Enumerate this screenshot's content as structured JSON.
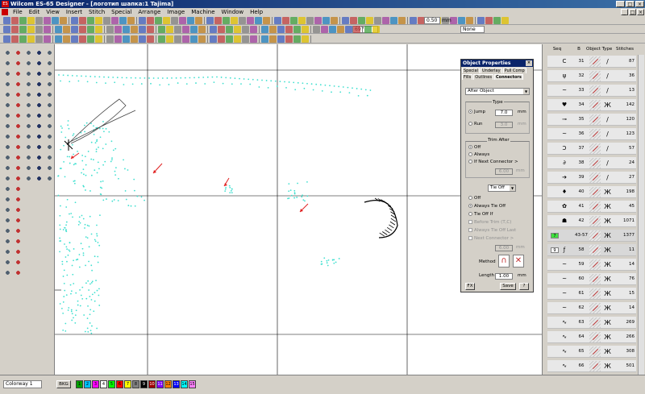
{
  "window": {
    "title": "Wilcom ES-65 Designer - [логотип шапка:1          Tajima]",
    "app_badge": "ES",
    "controls": [
      "_",
      "□",
      "×"
    ]
  },
  "menu": [
    "File",
    "Edit",
    "View",
    "Insert",
    "Stitch",
    "Special",
    "Arrange",
    "Image",
    "Machine",
    "Window",
    "Help"
  ],
  "toolbar": {
    "zoom_value": "697",
    "spacing_value": "0.50",
    "spacing_unit": "mm",
    "color_value": "None"
  },
  "object_properties": {
    "title": "Object Properties",
    "tabs_row1": [
      "Special",
      "Underlay",
      "Pull Comp"
    ],
    "tabs_row2": [
      "Fills",
      "Outlines",
      "Connectors"
    ],
    "active_tab": "Connectors",
    "connector_select": "After Object",
    "type_label": "Type",
    "jump_label": "Jump",
    "jump_value": "7.0",
    "run_label": "Run",
    "run_value": "3.0",
    "unit": "mm",
    "trim_after_label": "Trim After",
    "trim_off": "Off",
    "trim_always": "Always",
    "trim_if_next": "If Next Connector >",
    "trim_if_value": "6.00",
    "tie_select": "Tie Off",
    "tie_off": "Off",
    "tie_always": "Always Tie Off",
    "tie_if": "Tie Off If",
    "before_trim": "Before Trim (T,C)",
    "always_tie_last": "Always Tie Off Last",
    "next_connector": "Next Connector >",
    "next_value": "6.00",
    "method_label": "Method",
    "length_label": "Length",
    "length_value": "1.00",
    "btn_fx": "FX",
    "btn_save": "Save",
    "btn_help": "?"
  },
  "film_panel": {
    "headers": [
      "Seq",
      "B",
      "Object",
      "Type",
      "Stitches"
    ],
    "rows": [
      {
        "num": "31",
        "icon": "C",
        "type": "/",
        "stitches": "87"
      },
      {
        "num": "32",
        "icon": "ψ",
        "type": "/",
        "stitches": "36"
      },
      {
        "num": "33",
        "icon": "~",
        "type": "/",
        "stitches": "13"
      },
      {
        "num": "34",
        "icon": "♥",
        "type": "Ж",
        "stitches": "142"
      },
      {
        "num": "35",
        "icon": "⊸",
        "type": "/",
        "stitches": "120"
      },
      {
        "num": "36",
        "icon": "~",
        "type": "/",
        "stitches": "123"
      },
      {
        "num": "37",
        "icon": "Ɔ",
        "type": "/",
        "stitches": "57"
      },
      {
        "num": "38",
        "icon": "∂",
        "type": "/",
        "stitches": "24"
      },
      {
        "num": "39",
        "icon": "➔",
        "type": "/",
        "stitches": "27"
      },
      {
        "num": "40",
        "icon": "♦",
        "type": "Ж",
        "stitches": "198"
      },
      {
        "num": "41",
        "icon": "✿",
        "type": "Ж",
        "stitches": "45"
      },
      {
        "num": "42",
        "icon": "☗",
        "type": "Ж",
        "stitches": "1071"
      },
      {
        "num": "43-57",
        "icon": "",
        "type": "Ж",
        "stitches": "1377",
        "group": "7"
      },
      {
        "num": "58",
        "icon": "ƒ",
        "type": "Ж",
        "stitches": "11",
        "group": "9"
      },
      {
        "num": "59",
        "icon": "~",
        "type": "Ж",
        "stitches": "14"
      },
      {
        "num": "60",
        "icon": "~",
        "type": "Ж",
        "stitches": "76"
      },
      {
        "num": "61",
        "icon": "~",
        "type": "Ж",
        "stitches": "15"
      },
      {
        "num": "62",
        "icon": "~",
        "type": "Ж",
        "stitches": "14"
      },
      {
        "num": "63",
        "icon": "∿",
        "type": "Ж",
        "stitches": "269"
      },
      {
        "num": "64",
        "icon": "∿",
        "type": "Ж",
        "stitches": "266"
      },
      {
        "num": "65",
        "icon": "∿",
        "type": "Ж",
        "stitches": "308"
      },
      {
        "num": "66",
        "icon": "∿",
        "type": "Ж",
        "stitches": "501"
      }
    ]
  },
  "statusbar": {
    "colorway": "Colorway 1",
    "bkg_label": "BKG",
    "swatches": [
      {
        "n": "1",
        "color": "#00a000"
      },
      {
        "n": "2",
        "color": "#00c0ff"
      },
      {
        "n": "3",
        "color": "#ff00ff"
      },
      {
        "n": "4",
        "color": "#ffffff"
      },
      {
        "n": "5",
        "color": "#00ff00"
      },
      {
        "n": "6",
        "color": "#ff0000"
      },
      {
        "n": "7",
        "color": "#ffff00"
      },
      {
        "n": "8",
        "color": "#808080"
      },
      {
        "n": "9",
        "color": "#000000"
      },
      {
        "n": "10",
        "color": "#a00000"
      },
      {
        "n": "11",
        "color": "#8000ff"
      },
      {
        "n": "12",
        "color": "#ff8000"
      },
      {
        "n": "13",
        "color": "#0000ff"
      },
      {
        "n": "14",
        "color": "#00ffff"
      },
      {
        "n": "15",
        "color": "#ff80ff"
      }
    ],
    "right_items": [
      "",
      "",
      ""
    ]
  },
  "colors": {
    "stitch_dots": "#40e0d0",
    "arrows": "#e02020",
    "selection": "#0a246a"
  }
}
